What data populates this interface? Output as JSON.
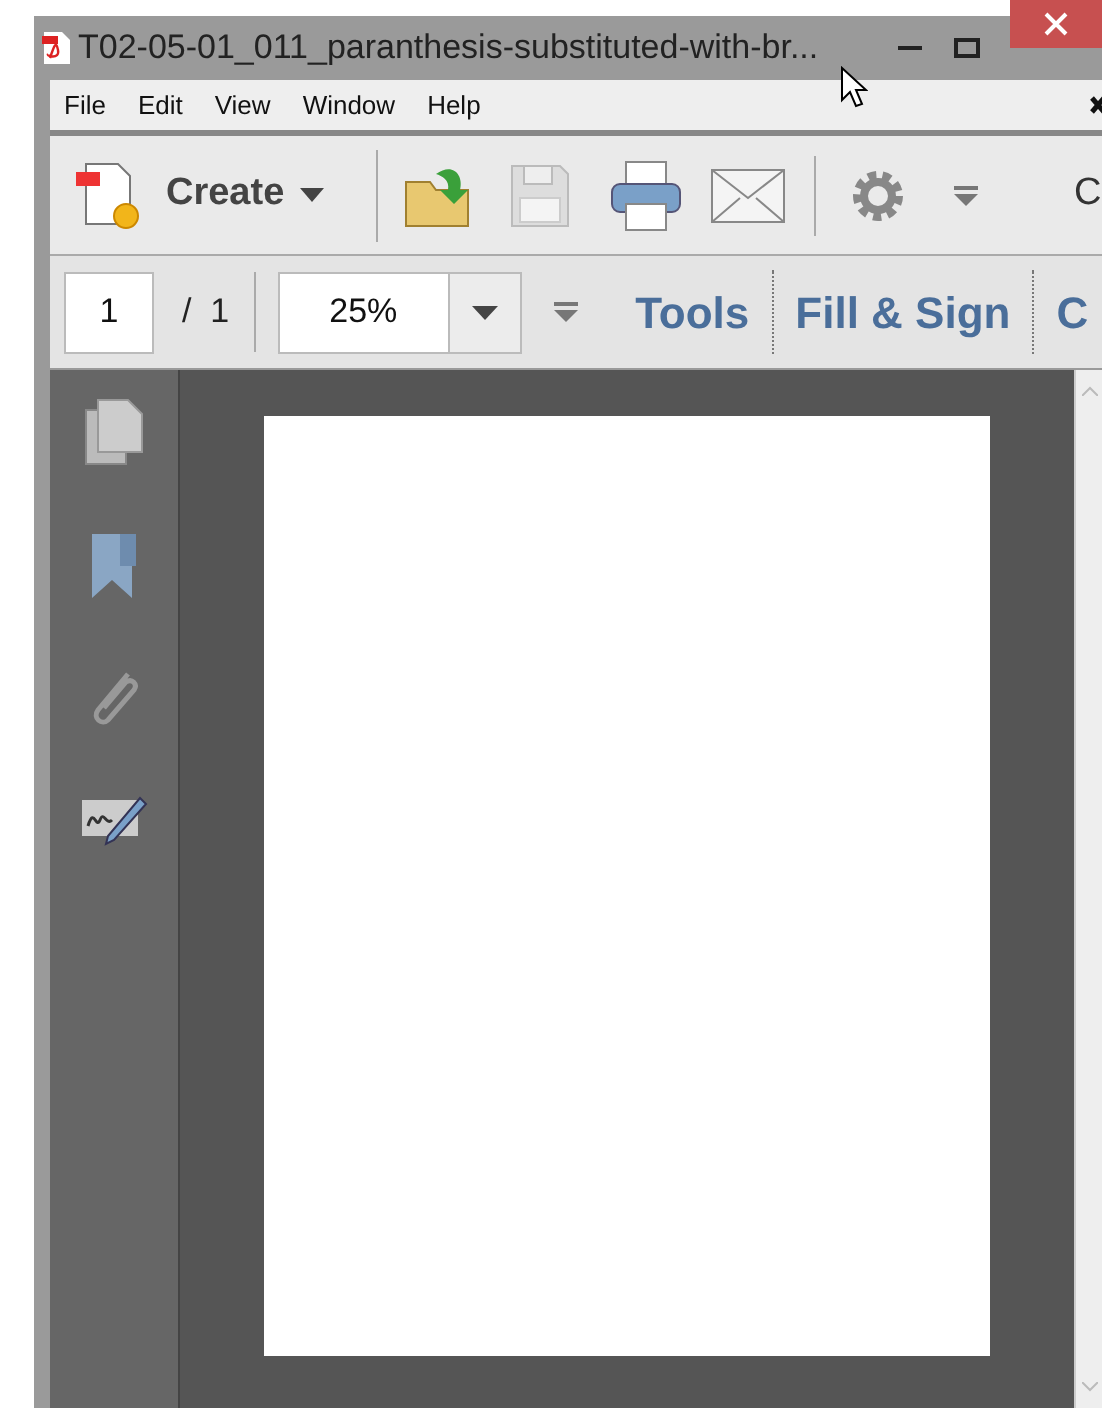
{
  "window": {
    "title": "T02-05-01_011_paranthesis-substituted-with-br..."
  },
  "menu": [
    "File",
    "Edit",
    "View",
    "Window",
    "Help"
  ],
  "toolbar": {
    "create": "Create",
    "cut_label": "C"
  },
  "navigation": {
    "page": "1",
    "page_total": "/ 1",
    "zoom": "25%",
    "tabs": [
      "Tools",
      "Fill & Sign",
      "C"
    ]
  }
}
